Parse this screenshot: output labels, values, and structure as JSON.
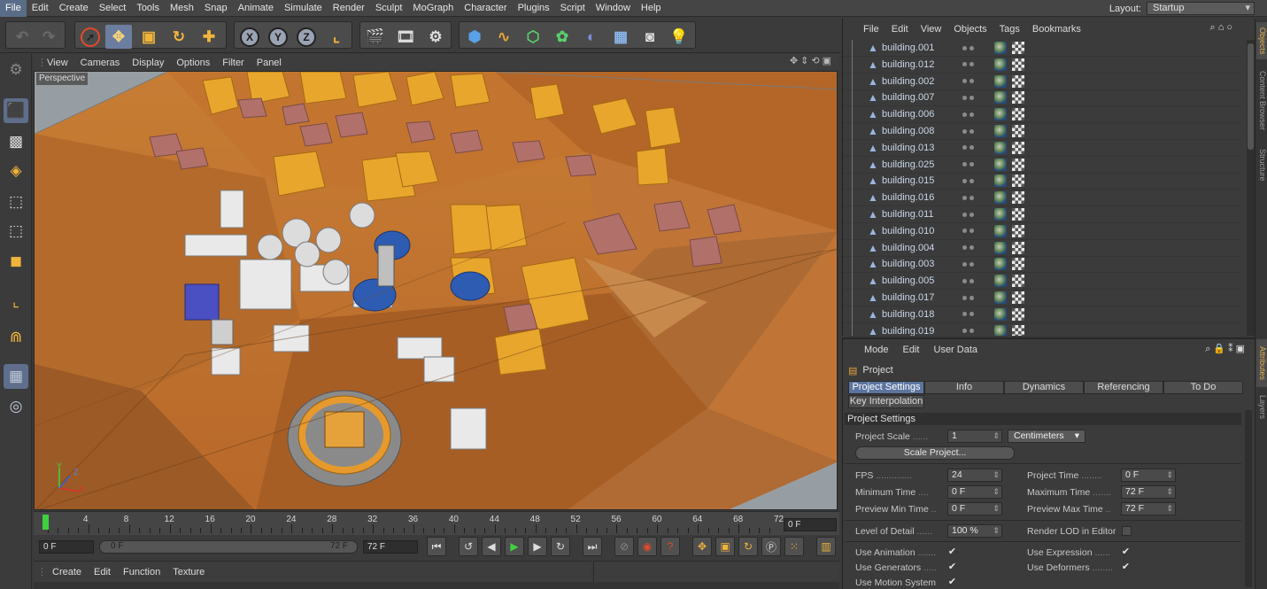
{
  "menubar": {
    "items": [
      "File",
      "Edit",
      "Create",
      "Select",
      "Tools",
      "Mesh",
      "Snap",
      "Animate",
      "Simulate",
      "Render",
      "Sculpt",
      "MoGraph",
      "Character",
      "Plugins",
      "Script",
      "Window",
      "Help"
    ],
    "layout_label": "Layout:",
    "layout_value": "Startup"
  },
  "toolbar": {
    "icons": [
      "undo-icon",
      "redo-icon",
      "live-selection-icon",
      "move-icon",
      "scale-icon",
      "rotate-icon",
      "last-tool-icon",
      "x-axis-icon",
      "y-axis-icon",
      "z-axis-icon",
      "coordinate-system-icon",
      "render-view-icon",
      "render-picture-viewer-icon",
      "render-settings-icon",
      "cube-icon",
      "spline-pen-icon",
      "subdivision-surface-icon",
      "cloner-icon",
      "deformer-icon",
      "floor-icon",
      "camera-icon",
      "light-icon"
    ],
    "axis_labels": [
      "X",
      "Y",
      "Z"
    ]
  },
  "viewport": {
    "menu": [
      "View",
      "Cameras",
      "Display",
      "Options",
      "Filter",
      "Panel"
    ],
    "label": "Perspective",
    "axis_gizmo": [
      "Y",
      "Z",
      "X"
    ]
  },
  "timeline": {
    "ticks": [
      "0",
      "4",
      "8",
      "12",
      "16",
      "20",
      "24",
      "28",
      "32",
      "36",
      "40",
      "44",
      "48",
      "52",
      "56",
      "60",
      "64",
      "68",
      "72"
    ],
    "current_frame": "0 F"
  },
  "playback": {
    "start_field": "0 F",
    "range_start": "0 F",
    "range_end": "72 F",
    "end_field": "72 F"
  },
  "material_manager": {
    "menu": [
      "Create",
      "Edit",
      "Function",
      "Texture"
    ]
  },
  "object_manager": {
    "menu": [
      "File",
      "Edit",
      "View",
      "Objects",
      "Tags",
      "Bookmarks"
    ],
    "objects": [
      "building.001",
      "building.012",
      "building.002",
      "building.007",
      "building.006",
      "building.008",
      "building.013",
      "building.025",
      "building.015",
      "building.016",
      "building.011",
      "building.010",
      "building.004",
      "building.003",
      "building.005",
      "building.017",
      "building.018",
      "building.019"
    ]
  },
  "side_tabs": {
    "top": [
      "Objects",
      "Content Browser",
      "Structure"
    ],
    "bottom": [
      "Attributes",
      "Layers"
    ]
  },
  "attributes": {
    "menu": [
      "Mode",
      "Edit",
      "User Data"
    ],
    "header": "Project",
    "tabs": [
      "Project Settings",
      "Info",
      "Dynamics",
      "Referencing",
      "To Do"
    ],
    "tab2": "Key Interpolation",
    "section": "Project Settings",
    "project_scale_label": "Project Scale",
    "project_scale_value": "1",
    "project_scale_unit": "Centimeters",
    "scale_project_button": "Scale Project...",
    "fps_label": "FPS",
    "fps_value": "24",
    "project_time_label": "Project Time",
    "project_time_value": "0 F",
    "min_time_label": "Minimum Time",
    "min_time_value": "0 F",
    "max_time_label": "Maximum Time",
    "max_time_value": "72 F",
    "preview_min_label": "Preview Min Time",
    "preview_min_value": "0 F",
    "preview_max_label": "Preview Max Time",
    "preview_max_value": "72 F",
    "lod_label": "Level of Detail",
    "lod_value": "100 %",
    "render_lod_label": "Render LOD in Editor",
    "use_animation_label": "Use Animation",
    "use_expression_label": "Use Expression",
    "use_generators_label": "Use Generators",
    "use_deformers_label": "Use Deformers",
    "use_motion_label": "Use Motion System"
  }
}
